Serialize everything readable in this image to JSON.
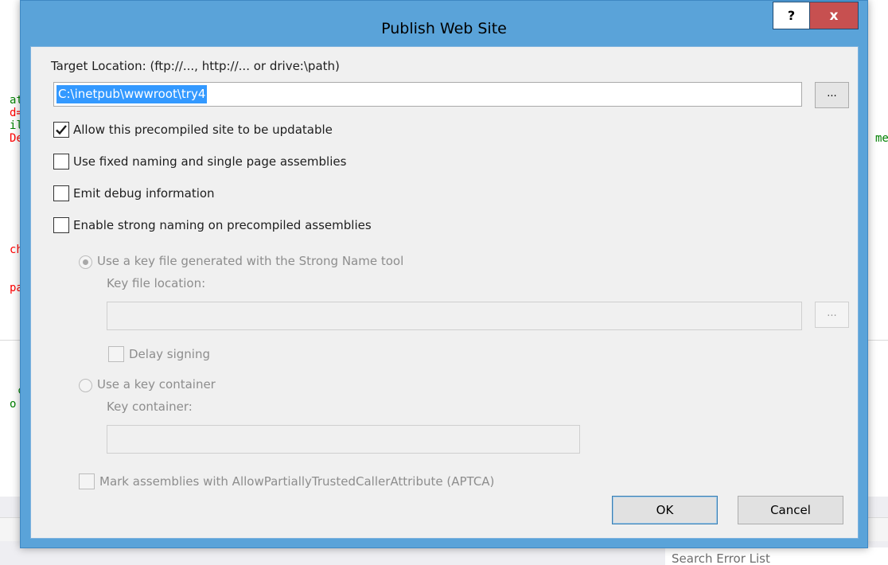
{
  "background": {
    "code_lines": [
      {
        "text": "at",
        "color": "#008000"
      },
      {
        "text": "d=",
        "color": "#ff0000"
      },
      {
        "text": "il",
        "color": "#008000"
      },
      {
        "text": "De",
        "color": "#ff0000"
      },
      {
        "text": "ch",
        "color": "#ff0000"
      },
      {
        "text": "pa",
        "color": "#ff0000"
      },
      {
        "text": "c",
        "color": "#008000"
      },
      {
        "text": "o",
        "color": "#008000"
      }
    ],
    "right_fragment": "me",
    "search_error_list": "Search Error List"
  },
  "dialog": {
    "title": "Publish Web Site",
    "help_label": "?",
    "close_label": "x",
    "target_location_label": "Target Location: (ftp://..., http://... or drive:\\path)",
    "target_location_value": "C:\\inetpub\\wwwroot\\try4",
    "browse_label": "...",
    "options": {
      "allow_updatable": {
        "label": "Allow this precompiled site to be updatable",
        "checked": true
      },
      "fixed_naming": {
        "label": "Use fixed naming and single page assemblies",
        "checked": false
      },
      "emit_debug": {
        "label": "Emit debug information",
        "checked": false
      },
      "strong_naming": {
        "label": "Enable strong naming on precompiled assemblies",
        "checked": false
      }
    },
    "strong_name": {
      "key_file_radio_label": "Use a key file generated with the Strong Name tool",
      "key_file_location_label": "Key file location:",
      "key_file_location_value": "",
      "browse_label": "...",
      "delay_signing_label": "Delay signing",
      "key_container_radio_label": "Use a key container",
      "key_container_label": "Key container:",
      "key_container_value": ""
    },
    "aptca_label": "Mark assemblies with AllowPartiallyTrustedCallerAttribute (APTCA)",
    "ok_label": "OK",
    "cancel_label": "Cancel"
  }
}
